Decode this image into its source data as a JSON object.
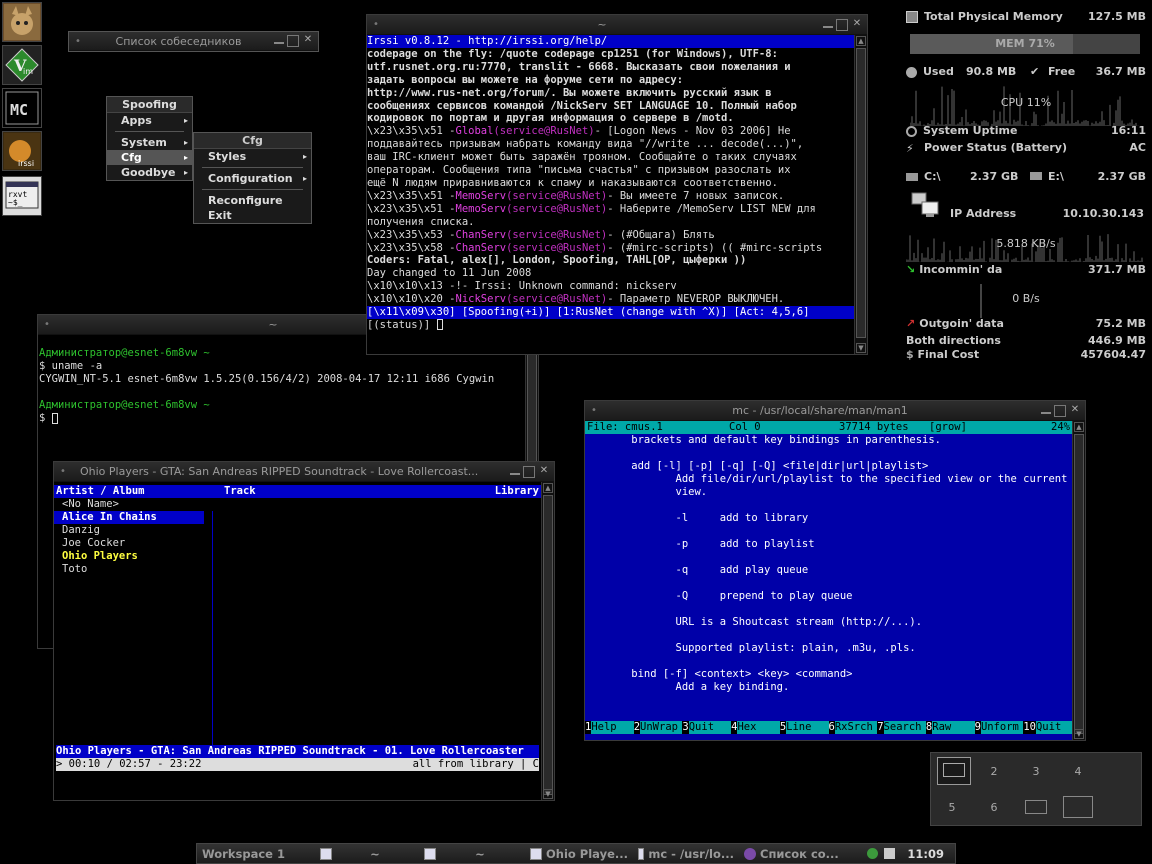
{
  "taskbar": {
    "workspace": "Workspace 1",
    "items": [
      "~",
      "~",
      "Ohio Playe...",
      "mc - /usr/lo...",
      "Список со..."
    ],
    "clock": "11:09"
  },
  "contacts_window": {
    "title": "Список собеседников"
  },
  "menu_main": {
    "items": [
      "Spoofing",
      "Apps",
      "System",
      "Cfg",
      "Goodbye"
    ]
  },
  "menu_cfg": {
    "title": "Cfg",
    "items": [
      "Styles",
      "Configuration",
      "Reconfigure",
      "Exit"
    ]
  },
  "irssi": {
    "title": "~",
    "header": "Irssi v0.8.12 - http://irssi.org/help/",
    "lines": [
      "         codepage on the fly: /quote codepage cp1251 (for Windows), UTF-8:",
      "         utf.rusnet.org.ru:7770, translit - 6668. Высказать свои пожелания и",
      "         задать вопросы вы можете на форуме сети по адресу:",
      "         http://www.rus-net.org/forum/. Вы можете включить русский язык в",
      "         сообщениях сервисов командой /NickServ SET LANGUAGE 10. Полный набор",
      "         кодировок по портам и другая информация о сервере в /motd."
    ],
    "global": {
      "prefix": "\\x23\\x35\\x51 -",
      "nick": "Global",
      "host": "(service@RusNet)",
      "text": "- [Logon News - Nov 03 2006] Не",
      "cont": [
        "         поддавайтесь призывам набрать команду вида \"//write ... decode(...)\",",
        "         ваш IRC-клиент может быть заражён трояном. Сообщайте о таких случаях",
        "         операторам. Сообщения типа \"письма счастья\" с призывом разослать их",
        "         ещё N людям приравниваются к спаму и наказываются соответственно."
      ]
    },
    "memo1": {
      "prefix": "\\x23\\x35\\x51 -",
      "nick": "MemoServ",
      "host": "(service@RusNet)",
      "text": "- Вы имеете 7 новых записок."
    },
    "memo2": {
      "prefix": "\\x23\\x35\\x51 -",
      "nick": "MemoServ",
      "host": "(service@RusNet)",
      "text": "- Наберите /MemoServ LIST NEW для",
      "cont": "         получения списка."
    },
    "chan1": {
      "prefix": "\\x23\\x35\\x53 -",
      "nick": "ChanServ",
      "host": "(service@RusNet)",
      "text": "- (#Общага) Блять"
    },
    "chan2": {
      "prefix": "\\x23\\x35\\x58 -",
      "nick": "ChanServ",
      "host": "(service@RusNet)",
      "text": "- (#mirc-scripts) (( #mirc-scripts",
      "cont": "         Coders: Fatal, alex[], London, Spoofing, TAHL[OP, цыферки ))"
    },
    "day": "Day changed to 11 Jun 2008",
    "unknown": "\\x10\\x10\\x13  -!- Irssi: Unknown command: nickserv",
    "nick3": {
      "prefix": "\\x10\\x10\\x20 -",
      "nick": "NickServ",
      "host": "(service@RusNet)",
      "text": "- Параметр NEVEROP ВЫКЛЮЧЕН."
    },
    "statusbar": " [\\x11\\x09\\x30] [Spoofing(+i)] [1:RusNet (change with ^X)] [Act: 4,5,6]",
    "prompt": "[(status)] "
  },
  "terminal": {
    "title": "~",
    "prompt1": "Администратор@esnet-6m8vw ~",
    "cmd1": "$ uname -a",
    "out1": "CYGWIN_NT-5.1 esnet-6m8vw 1.5.25(0.156/4/2) 2008-04-17 12:11 i686 Cygwin",
    "prompt2": "Администратор@esnet-6m8vw ~",
    "cmd2": "$ "
  },
  "cmus": {
    "title": "Ohio Players - GTA: San Andreas RIPPED Soundtrack - Love Rollercoast...",
    "header": {
      "artist": " Artist / Album",
      "track": "Track",
      "library": "Library "
    },
    "artists": [
      "<No Name>",
      "Alice In Chains",
      "Danzig",
      "Joe Cocker",
      "Ohio Players",
      "Toto"
    ],
    "nowplaying": " Ohio Players - GTA: San Andreas RIPPED Soundtrack - 01. Love Rollercoaster",
    "status_left": " > 00:10 / 02:57 - 23:22",
    "status_right": "all from library | C "
  },
  "mc": {
    "title": "mc - /usr/local/share/man/man1",
    "header": {
      "file": "File: cmus.1",
      "col": "Col 0",
      "bytes": "37714 bytes",
      "grow": "[grow]",
      "pct": "24%"
    },
    "lines": [
      "       brackets and default key bindings in parenthesis.",
      "",
      "       add [-l] [-p] [-q] [-Q] <file|dir|url|playlist>",
      "              Add file/dir/url/playlist to the specified view or the current",
      "              view.",
      "",
      "              -l     add to library",
      "",
      "              -p     add to playlist",
      "",
      "              -q     add play queue",
      "",
      "              -Q     prepend to play queue",
      "",
      "              URL is a Shoutcast stream (http://...).",
      "",
      "              Supported playlist: plain, .m3u, .pls.",
      "",
      "       bind [-f] <context> <key> <command>",
      "              Add a key binding."
    ],
    "fkeys": [
      {
        "n": "1",
        "label": "Help"
      },
      {
        "n": "2",
        "label": "UnWrap"
      },
      {
        "n": "3",
        "label": "Quit"
      },
      {
        "n": "4",
        "label": "Hex"
      },
      {
        "n": "5",
        "label": "Line"
      },
      {
        "n": "6",
        "label": "RxSrch"
      },
      {
        "n": "7",
        "label": "Search"
      },
      {
        "n": "8",
        "label": "Raw"
      },
      {
        "n": "9",
        "label": "Unform"
      },
      {
        "n": "10",
        "label": "Quit"
      }
    ]
  },
  "conky": {
    "total_mem_label": "Total Physical Memory",
    "total_mem": "127.5 MB",
    "mem_bar": "MEM 71%",
    "mem_pct": 71,
    "used_label": "Used",
    "used": "90.8 MB",
    "free_label": "Free",
    "free": "36.7 MB",
    "cpu": "CPU 11%",
    "uptime_label": "System Uptime",
    "uptime": "16:11",
    "power_label": "Power Status (Battery)",
    "power": "AC",
    "c_label": "C:\\",
    "c_val": "2.37 GB",
    "e_label": "E:\\",
    "e_val": "2.37 GB",
    "ip_label": "IP Address",
    "ip": "10.10.30.143",
    "in_rate": "5.818 KB/s",
    "in_label": "Incommin' da",
    "in_total": "371.7 MB",
    "out_rate": "0 B/s",
    "out_label": "Outgoin' data",
    "out_total": "75.2 MB",
    "both_label": "Both directions",
    "both_total": "446.9 MB",
    "cost_label": "Final Cost",
    "cost": "457604.47"
  },
  "pager": {
    "cells": [
      "",
      "2",
      "3",
      "4",
      "5",
      "6",
      "",
      ""
    ]
  }
}
